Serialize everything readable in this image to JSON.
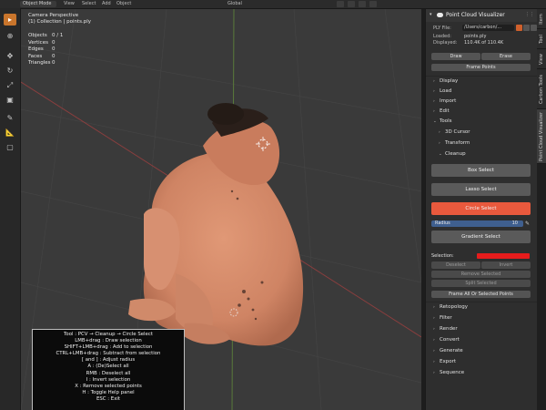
{
  "topbar": {
    "mode": "Object Mode",
    "menus": [
      "View",
      "Select",
      "Add",
      "Object"
    ],
    "transform": "Global"
  },
  "viewport": {
    "camera": "Camera Perspective",
    "collection": "(1) Collection | points.ply",
    "stats": [
      {
        "key": "Objects",
        "value": "0 / 1"
      },
      {
        "key": "Vertices",
        "value": "0"
      },
      {
        "key": "Edges",
        "value": "0"
      },
      {
        "key": "Faces",
        "value": "0"
      },
      {
        "key": "Triangles",
        "value": "0"
      }
    ]
  },
  "help": {
    "lines": [
      "Tool : PCV → Cleanup → Circle Select",
      "LMB+drag : Draw selection",
      "SHIFT+LMB+drag : Add to selection",
      "CTRL+LMB+drag : Subtract from selection",
      "[ and ] : Adjust radius",
      "A : (De)Select all",
      "RMB : Deselect all",
      "I : Invert selection",
      "X : Remove selected points",
      "H : Toggle Help panel",
      "ESC : Exit"
    ]
  },
  "panel": {
    "title": "Point Cloud Visualizer",
    "ply_label": "PLY File:",
    "ply_value": "/Users/carbon/...",
    "loaded_label": "Loaded:",
    "loaded_value": "points.ply",
    "displayed_label": "Displayed:",
    "displayed_value": "110.4K of 110.4K",
    "draw": "Draw",
    "erase": "Erase",
    "frame_points": "Frame Points",
    "sections_top": [
      "Display",
      "Load",
      "Import",
      "Edit",
      "Tools"
    ],
    "tools_sub": [
      "3D Cursor",
      "Transform",
      "Cleanup"
    ],
    "box_select": "Box Select",
    "lasso_select": "Lasso Select",
    "circle_select": "Circle Select",
    "radius_label": "Radius",
    "radius_value": "10",
    "gradient_select": "Gradient Select",
    "selection_label": "Selection:",
    "deselect": "Deselect",
    "invert": "Invert",
    "remove_selected": "Remove Selected",
    "split_selected": "Split Selected",
    "frame_all": "Frame All Or Selected Points",
    "sections_bottom": [
      "Retopology",
      "Filter",
      "Render",
      "Convert",
      "Generate",
      "Export",
      "Sequence"
    ]
  },
  "tabs": [
    "Item",
    "Tool",
    "View",
    "Carbon Tools",
    "Point Cloud Visualizer"
  ],
  "colors": {
    "accent": "#e9593d",
    "selection": "#e61c1c",
    "active_tool": "#c9752c",
    "figure": "#d4896a"
  }
}
